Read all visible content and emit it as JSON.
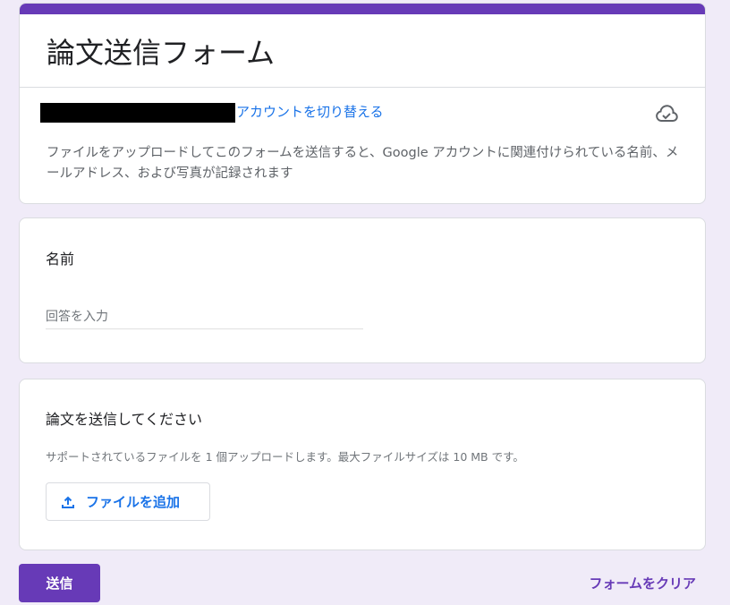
{
  "header": {
    "title": "論文送信フォーム",
    "switch_account": "アカウントを切り替える",
    "cloud_icon": "cloud-done-icon",
    "description": "ファイルをアップロードしてこのフォームを送信すると、Google アカウントに関連付けられている名前、メールアドレス、および写真が記録されます"
  },
  "name_question": {
    "label": "名前",
    "placeholder": "回答を入力"
  },
  "file_question": {
    "label": "論文を送信してください",
    "hint": "サポートされているファイルを 1 個アップロードします。最大ファイルサイズは 10 MB です。",
    "add_file": "ファイルを追加",
    "icon": "upload-icon"
  },
  "footer": {
    "submit": "送信",
    "clear": "フォームをクリア"
  },
  "colors": {
    "accent": "#673ab7",
    "link": "#1a73e8",
    "background": "#f0ebf8"
  }
}
